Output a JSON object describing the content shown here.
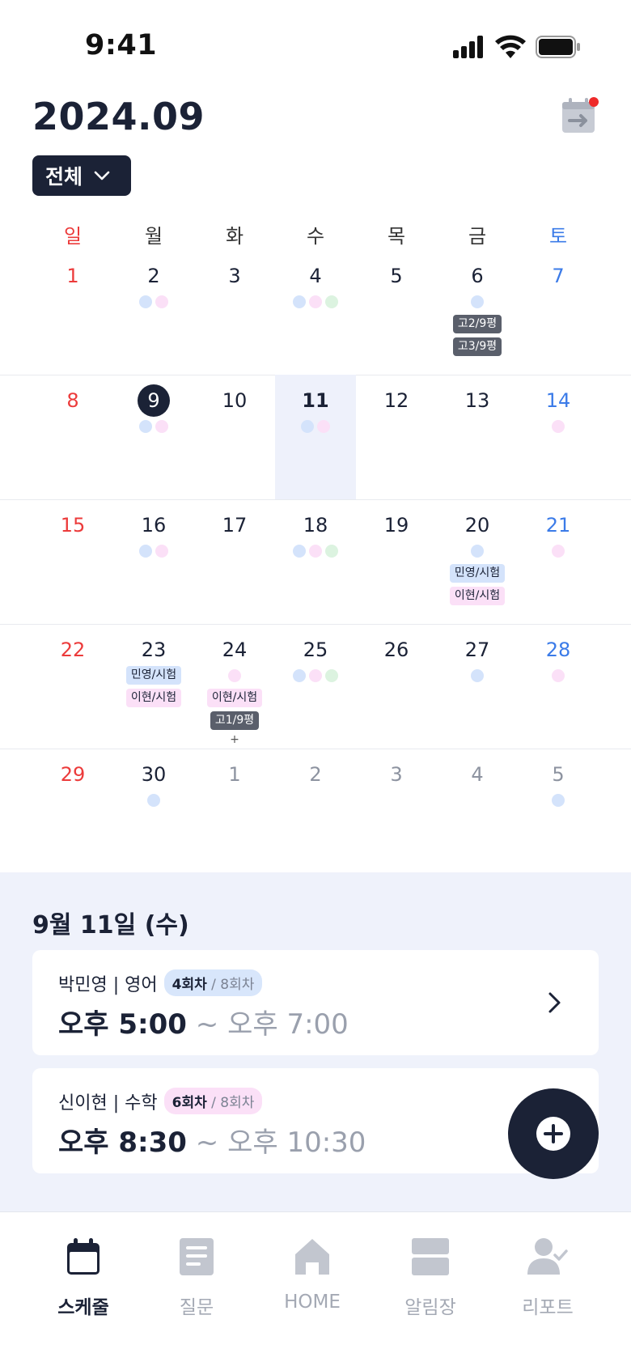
{
  "status_bar": {
    "time": "9:41"
  },
  "header": {
    "month": "2024.09",
    "filter_label": "전체"
  },
  "weekdays": [
    "일",
    "월",
    "화",
    "수",
    "목",
    "금",
    "토"
  ],
  "weeks": [
    [
      {
        "d": "1"
      },
      {
        "d": "2",
        "dots": [
          "blue",
          "pink"
        ]
      },
      {
        "d": "3"
      },
      {
        "d": "4",
        "dots": [
          "blue",
          "pink",
          "green"
        ]
      },
      {
        "d": "5"
      },
      {
        "d": "6",
        "dots": [
          "blue"
        ],
        "tags": [
          {
            "t": "고2/9평",
            "c": "dark"
          },
          {
            "t": "고3/9평",
            "c": "dark"
          }
        ]
      },
      {
        "d": "7"
      }
    ],
    [
      {
        "d": "8"
      },
      {
        "d": "9",
        "selected": true,
        "dots": [
          "blue",
          "pink"
        ]
      },
      {
        "d": "10"
      },
      {
        "d": "11",
        "today": true,
        "dots": [
          "blue",
          "pink"
        ]
      },
      {
        "d": "12"
      },
      {
        "d": "13"
      },
      {
        "d": "14",
        "dots": [
          "pink"
        ]
      }
    ],
    [
      {
        "d": "15"
      },
      {
        "d": "16",
        "dots": [
          "blue",
          "pink"
        ]
      },
      {
        "d": "17"
      },
      {
        "d": "18",
        "dots": [
          "blue",
          "pink",
          "green"
        ]
      },
      {
        "d": "19"
      },
      {
        "d": "20",
        "dots": [
          "blue"
        ],
        "tags": [
          {
            "t": "민영/시험",
            "c": "blue"
          },
          {
            "t": "이현/시험",
            "c": "pink"
          }
        ]
      },
      {
        "d": "21",
        "dots": [
          "pink"
        ]
      }
    ],
    [
      {
        "d": "22"
      },
      {
        "d": "23",
        "tags": [
          {
            "t": "민영/시험",
            "c": "blue"
          },
          {
            "t": "이현/시험",
            "c": "pink"
          }
        ]
      },
      {
        "d": "24",
        "dots": [
          "pink"
        ],
        "tags": [
          {
            "t": "이현/시험",
            "c": "pink"
          },
          {
            "t": "고1/9평",
            "c": "dark"
          }
        ],
        "more": "+"
      },
      {
        "d": "25",
        "dots": [
          "blue",
          "pink",
          "green"
        ]
      },
      {
        "d": "26"
      },
      {
        "d": "27",
        "dots": [
          "blue"
        ]
      },
      {
        "d": "28",
        "dots": [
          "pink"
        ]
      }
    ],
    [
      {
        "d": "29"
      },
      {
        "d": "30",
        "dots": [
          "blue"
        ]
      },
      {
        "d": "1",
        "other": true
      },
      {
        "d": "2",
        "other": true
      },
      {
        "d": "3",
        "other": true
      },
      {
        "d": "4",
        "other": true
      },
      {
        "d": "5",
        "other": true,
        "dots": [
          "blue"
        ]
      }
    ]
  ],
  "schedule": {
    "date_label": "9월 11일 (수)",
    "lessons": [
      {
        "title": "박민영 | 영어",
        "session": "4회차",
        "total": " / 8회차",
        "color": "blue",
        "start": "오후 5:00",
        "end": " ~ 오후 7:00"
      },
      {
        "title": "신이현 | 수학",
        "session": "6회차",
        "total": " / 8회차",
        "color": "pink",
        "start": "오후 8:30",
        "end": " ~ 오후 10:30"
      }
    ]
  },
  "tabs": [
    {
      "label": "스케줄",
      "icon": "calendar-icon",
      "active": true
    },
    {
      "label": "질문",
      "icon": "document-icon"
    },
    {
      "label": "HOME",
      "icon": "home-icon"
    },
    {
      "label": "알림장",
      "icon": "notice-icon"
    },
    {
      "label": "리포트",
      "icon": "report-icon"
    }
  ]
}
